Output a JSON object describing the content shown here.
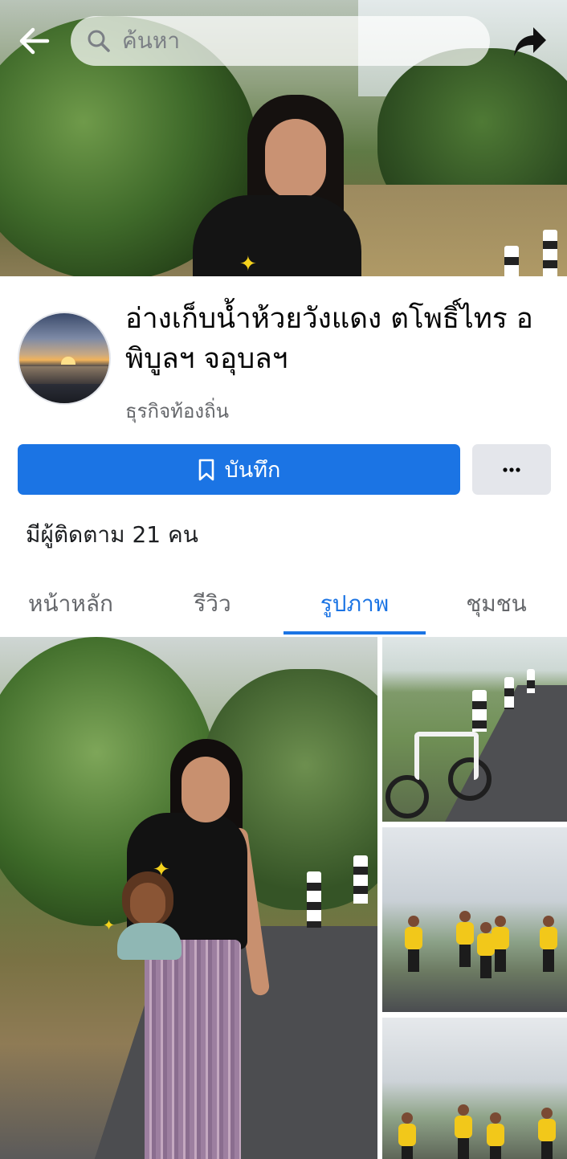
{
  "topbar": {
    "search_placeholder": "ค้นหา",
    "back_icon": "arrow-left-icon",
    "share_icon": "share-arrow-icon"
  },
  "page": {
    "name": "อ่างเก็บน้ำห้วยวังแดง ตโพธิ์ไทร อพิบูลฯ จอุบลฯ",
    "category": "ธุรกิจท้องถิ่น",
    "followers": "มีผู้ติดตาม 21 คน"
  },
  "actions": {
    "save_label": "บันทึก",
    "more_label": "···"
  },
  "tabs": [
    {
      "label": "หน้าหลัก",
      "active": false
    },
    {
      "label": "รีวิว",
      "active": false
    },
    {
      "label": "รูปภาพ",
      "active": true
    },
    {
      "label": "ชุมชน",
      "active": false
    }
  ],
  "colors": {
    "accent": "#1b74e4",
    "secondary_button": "#e4e6eb",
    "muted_text": "#65676b"
  }
}
